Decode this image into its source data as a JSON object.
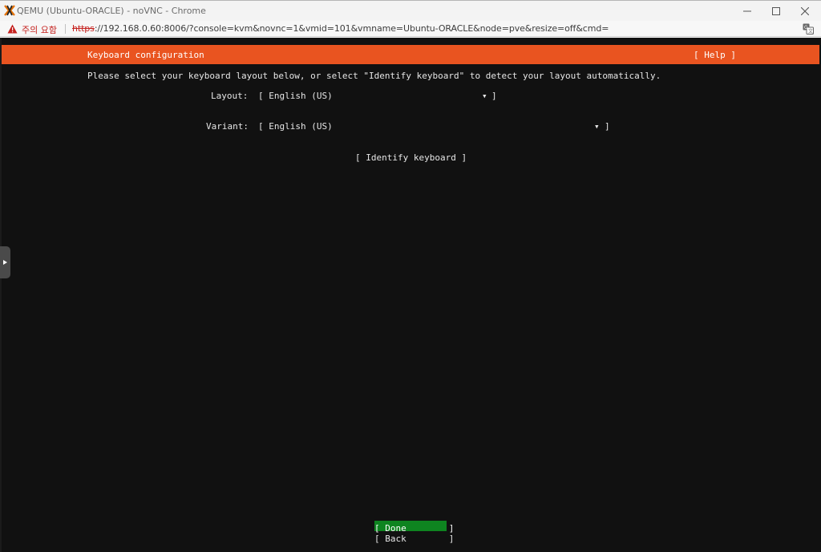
{
  "window": {
    "title": "QEMU (Ubuntu-ORACLE) - noVNC - Chrome"
  },
  "addressbar": {
    "warning": "주의 요함",
    "url_scheme": "https",
    "url_rest": "://192.168.0.60:8006/?console=kvm&novnc=1&vmid=101&vmname=Ubuntu-ORACLE&node=pve&resize=off&cmd="
  },
  "installer": {
    "header_title": "Keyboard configuration",
    "help": "[ Help ]",
    "instructions": "Please select your keyboard layout below, or select \"Identify keyboard\" to detect your layout automatically.",
    "layout_label": "Layout:",
    "layout_value": "[ English (US)",
    "variant_label": "Variant:",
    "variant_value": "[ English (US)",
    "dropdown_arrow": "▾",
    "dropdown_close": "]",
    "identify": "[ Identify keyboard ]",
    "done": "[ Done        ]",
    "back": "[ Back        ]"
  },
  "colors": {
    "accent": "#e95420",
    "done_bg": "#0e8420",
    "console_bg": "#111111"
  }
}
